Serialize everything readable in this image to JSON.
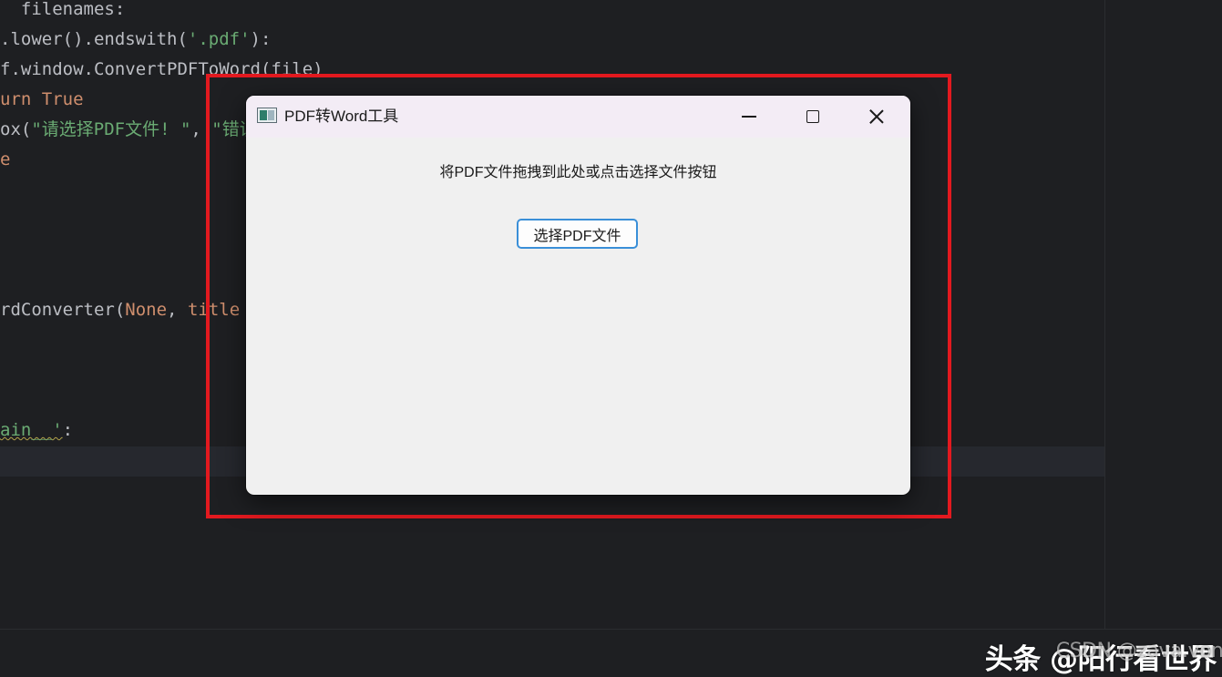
{
  "editor": {
    "lines": [
      {
        "segments": [
          {
            "text": "  filenames:",
            "cls": ""
          }
        ]
      },
      {
        "segments": [
          {
            "text": ".lower().endswith(",
            "cls": ""
          },
          {
            "text": "'.pdf'",
            "cls": "tok-str"
          },
          {
            "text": "):",
            "cls": ""
          }
        ]
      },
      {
        "segments": [
          {
            "text": "f.window.ConvertPDFToWord(file)",
            "cls": ""
          }
        ]
      },
      {
        "segments": [
          {
            "text": "urn ",
            "cls": "tok-kw"
          },
          {
            "text": "True",
            "cls": "tok-kw"
          }
        ]
      },
      {
        "segments": [
          {
            "text": "ox(",
            "cls": ""
          },
          {
            "text": "\"请选择PDF文件! \"",
            "cls": "tok-str"
          },
          {
            "text": ", ",
            "cls": ""
          },
          {
            "text": "\"错误\"",
            "cls": "tok-str"
          }
        ]
      },
      {
        "segments": [
          {
            "text": "e",
            "cls": "tok-kw"
          }
        ]
      },
      {
        "segments": []
      },
      {
        "segments": []
      },
      {
        "segments": []
      },
      {
        "segments": []
      },
      {
        "segments": [
          {
            "text": "rdConverter(",
            "cls": ""
          },
          {
            "text": "None",
            "cls": "tok-kw"
          },
          {
            "text": ", ",
            "cls": ""
          },
          {
            "text": "title",
            "cls": "tok-kw"
          }
        ]
      },
      {
        "segments": []
      },
      {
        "segments": []
      },
      {
        "segments": []
      },
      {
        "segments": [
          {
            "text": "ain__'",
            "cls": "tok-str tok-warn"
          },
          {
            "text": ":",
            "cls": ""
          }
        ]
      }
    ]
  },
  "window": {
    "title": "PDF转Word工具",
    "instruction": "将PDF文件拖拽到此处或点击选择文件按钮",
    "select_button_label": "选择PDF文件"
  },
  "watermark": {
    "text": "头条 @阳行看世界",
    "ghost_text": "CSDN @zava.vong"
  },
  "colors": {
    "editor_bg": "#1e1f22",
    "highlight": "#e3191f",
    "keyword": "#cf8e6d",
    "string": "#6aab73",
    "button_border": "#3a8fd8"
  },
  "icons": {
    "app": "window-app-icon",
    "minimize": "minimize-icon",
    "maximize": "maximize-icon",
    "close": "close-icon"
  }
}
